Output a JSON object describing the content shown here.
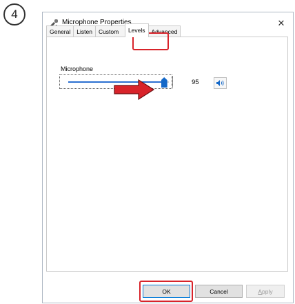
{
  "step": {
    "number": "4"
  },
  "window": {
    "title": "Microphone Properties",
    "close": "✕"
  },
  "tabs": [
    {
      "label": "General"
    },
    {
      "label": "Listen"
    },
    {
      "label": "Custom"
    },
    {
      "label": "Levels"
    },
    {
      "label": "Advanced"
    }
  ],
  "levels": {
    "device_label": "Microphone",
    "value": "95",
    "slider_fraction": 0.95
  },
  "buttons": {
    "ok": "OK",
    "cancel": "Cancel",
    "apply_prefix": "A",
    "apply_rest": "pply"
  },
  "colors": {
    "accent": "#1468c8",
    "annotation": "#d8232a"
  }
}
